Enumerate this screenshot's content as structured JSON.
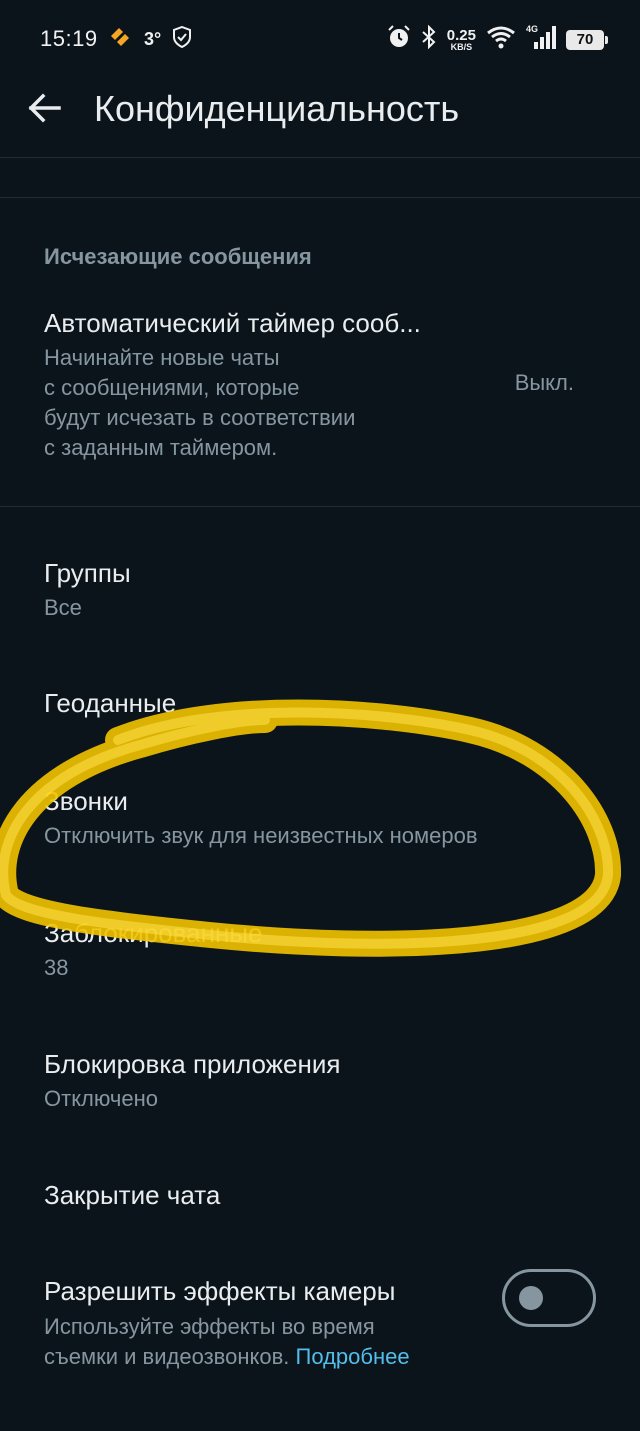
{
  "status_bar": {
    "time": "15:19",
    "temperature": "3°",
    "net_speed": "0.25",
    "net_speed_unit": "KB/S",
    "network": "4G",
    "battery": "70",
    "icons": [
      "app-notification-icon",
      "shield-icon",
      "alarm-icon",
      "bluetooth-icon",
      "wifi-icon",
      "signal-icon",
      "battery-icon"
    ]
  },
  "app_bar": {
    "back_icon": "arrow-left-icon",
    "title": "Конфиденциальность"
  },
  "disappearing": {
    "header": "Исчезающие сообщения",
    "timer_title": "Автоматический таймер сооб...",
    "timer_desc": [
      "Начинайте новые чаты",
      "с сообщениями, которые",
      "будут исчезать в соответствии",
      "с заданным таймером."
    ],
    "timer_value": "Выкл."
  },
  "groups": {
    "title": "Группы",
    "value": "Все"
  },
  "location": {
    "title": "Геоданные"
  },
  "calls": {
    "title": "Звонки",
    "value": "Отключить звук для неизвестных номеров"
  },
  "blocked": {
    "title": "Заблокированные",
    "value": "38"
  },
  "app_lock": {
    "title": "Блокировка приложения",
    "value": "Отключено"
  },
  "chat_lock": {
    "title": "Закрытие чата"
  },
  "camera_effects": {
    "title": "Разрешить эффекты камеры",
    "desc_line1": "Используйте эффекты во время",
    "desc_line2": "съемки и видеозвонков.",
    "link": "Подробнее",
    "enabled": false
  },
  "colors": {
    "background": "#0b141a",
    "primary_text": "#e9edef",
    "secondary_text": "#8696a0",
    "link": "#53bdeb",
    "highlight_scribble": "#f2c200"
  }
}
